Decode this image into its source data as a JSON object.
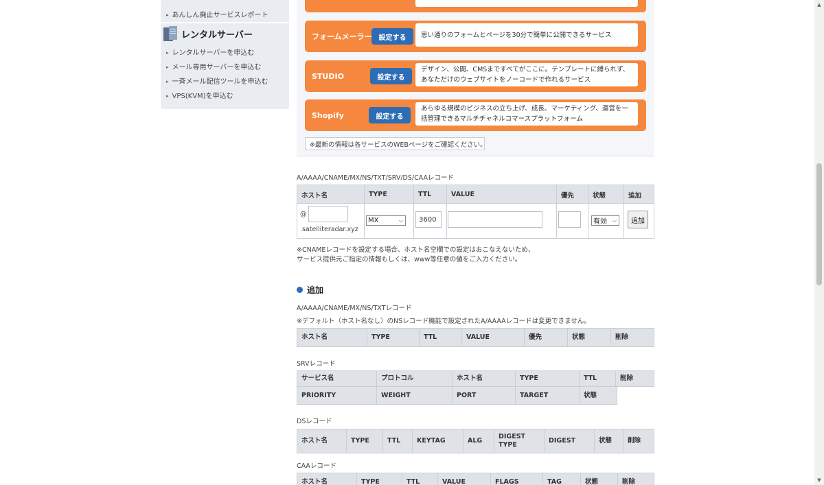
{
  "sidebar": {
    "top_item": "あんしん廃止サービスレポート",
    "heading": "レンタルサーバー",
    "items": [
      "レンタルサーバーを申込む",
      "メール専用サーバーを申込む",
      "一斉メール配信ツールを申込む",
      "VPS(KVM)を申込む"
    ]
  },
  "services": [
    {
      "name": "フォームメーラー",
      "button": "設定する",
      "desc": "思い通りのフォームとページを30分で簡単に公開できるサービス"
    },
    {
      "name": "STUDIO",
      "button": "設定する",
      "desc": "デザイン、公開、CMSまですべてがここに。テンプレートに縛られず、あなただけのウェブサイトをノーコードで作れるサービス"
    },
    {
      "name": "Shopify",
      "button": "設定する",
      "desc": "あらゆる規模のビジネスの立ち上げ、成長、マーケティング、運営を一括管理できるマルチチャネルコマースプラットフォーム"
    }
  ],
  "service_note": "※最新の情報は各サービスのWEBページをご確認ください。",
  "record_form": {
    "caption": "A/AAAA/CNAME/MX/NS/TXT/SRV/DS/CAAレコード",
    "headers": [
      "ホスト名",
      "TYPE",
      "TTL",
      "VALUE",
      "優先",
      "状態",
      "追加"
    ],
    "at_sign": "@",
    "host_value": "",
    "domain_suffix": ".satelliteradar.xyz",
    "type_value": "MX",
    "ttl_value": "3600",
    "value_value": "",
    "priority_value": "",
    "status_value": "有効",
    "add_button": "追加",
    "note_line1": "※CNAMEレコードを設定する場合、ホスト名空欄での設定はおこなえないため、",
    "note_line2": "サービス提供元ご指定の情報もしくは、www等任意の値をご入力ください。"
  },
  "add_section": {
    "title": "追加",
    "a_caption": "A/AAAA/CNAME/MX/NS/TXTレコード",
    "a_note": "※デフォルト（ホスト名なし）のNSレコード機能で設定されたA/AAAAレコードは変更できません。",
    "a_headers": [
      "ホスト名",
      "TYPE",
      "TTL",
      "VALUE",
      "優先",
      "状態",
      "削除"
    ],
    "srv_caption": "SRVレコード",
    "srv_headers1": [
      "サービス名",
      "プロトコル",
      "ホスト名",
      "TYPE",
      "TTL",
      "削除"
    ],
    "srv_headers2": [
      "PRIORITY",
      "WEIGHT",
      "PORT",
      "TARGET",
      "状態"
    ],
    "ds_caption": "DSレコード",
    "ds_headers": [
      "ホスト名",
      "TYPE",
      "TTL",
      "KEYTAG",
      "ALG",
      "DIGEST TYPE",
      "DIGEST",
      "状態",
      "削除"
    ],
    "caa_caption": "CAAレコード",
    "caa_headers": [
      "ホスト名",
      "TYPE",
      "TTL",
      "VALUE",
      "FLAGS",
      "TAG",
      "状態",
      "削除"
    ]
  }
}
